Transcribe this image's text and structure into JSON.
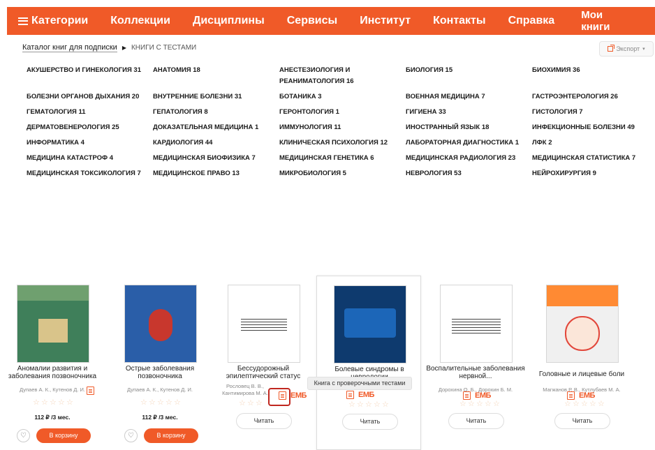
{
  "nav": {
    "categories": "Категории",
    "items": [
      "Коллекции",
      "Дисциплины",
      "Сервисы",
      "Институт",
      "Контакты",
      "Справка"
    ],
    "my_books": "Мои книги"
  },
  "breadcrumb": {
    "catalog": "Каталог книг для подписки",
    "separator": "▶",
    "current": "КНИГИ С ТЕСТАМИ"
  },
  "export": {
    "label": "Экспорт"
  },
  "categories": [
    "АКУШЕРСТВО И ГИНЕКОЛОГИЯ 31",
    "АНАТОМИЯ 18",
    "АНЕСТЕЗИОЛОГИЯ И РЕАНИМАТОЛОГИЯ 16",
    "БИОЛОГИЯ 15",
    "БИОХИМИЯ 36",
    "БОЛЕЗНИ ОРГАНОВ ДЫХАНИЯ 20",
    "ВНУТРЕННИЕ БОЛЕЗНИ 31",
    "БОТАНИКА 3",
    "ВОЕННАЯ МЕДИЦИНА 7",
    "ГАСТРОЭНТЕРОЛОГИЯ 26",
    "ГЕМАТОЛОГИЯ 11",
    "ГЕПАТОЛОГИЯ 8",
    "ГЕРОНТОЛОГИЯ 1",
    "ГИГИЕНА 33",
    "ГИСТОЛОГИЯ 7",
    "ДЕРМАТОВЕНЕРОЛОГИЯ 25",
    "ДОКАЗАТЕЛЬНАЯ МЕДИЦИНА 1",
    "ИММУНОЛОГИЯ 11",
    "ИНОСТРАННЫЙ ЯЗЫК 18",
    "ИНФЕКЦИОННЫЕ БОЛЕЗНИ 49",
    "ИНФОРМАТИКА 4",
    "КАРДИОЛОГИЯ 44",
    "КЛИНИЧЕСКАЯ ПСИХОЛОГИЯ 12",
    "ЛАБОРАТОРНАЯ ДИАГНОСТИКА 1",
    "ЛФК 2",
    "МЕДИЦИНА КАТАСТРОФ 4",
    "МЕДИЦИНСКАЯ БИОФИЗИКА 7",
    "МЕДИЦИНСКАЯ ГЕНЕТИКА 6",
    "МЕДИЦИНСКАЯ РАДИОЛОГИЯ 23",
    "МЕДИЦИНСКАЯ СТАТИСТИКА 7",
    "МЕДИЦИНСКАЯ ТОКСИКОЛОГИЯ 7",
    "МЕДИЦИНСКОЕ ПРАВО 13",
    "МИКРОБИОЛОГИЯ 5",
    "НЕВРОЛОГИЯ 53",
    "НЕЙРОХИРУРГИЯ 9"
  ],
  "books": [
    {
      "title": "Аномалии развития и заболевания позвоночника",
      "authors": "Дупаев А. К., Кутенов Д. И.",
      "rating": 0,
      "price": "112 ₽ /3 мес.",
      "cart": "В корзину",
      "has_test": true,
      "cover": [
        "#3f7f5a",
        "#d9c48a",
        "#6fa06f"
      ]
    },
    {
      "title": "Острые заболевания позвоночника",
      "authors": "Дупаев А. К., Кутенов Д. И.",
      "rating": 0,
      "price": "112 ₽ /3 мес.",
      "cart": "В корзину",
      "has_test": false,
      "cover": [
        "#2a5ea8",
        "#c8372d",
        "#2a5ea8"
      ]
    },
    {
      "title": "Бессудорожный эпилептический статус",
      "authors": "Рословец В. В., Кантимирова М. А.",
      "rating": 0,
      "read": "Читать",
      "has_test": true,
      "evm": "ЕМБ",
      "cover": [
        "#ffffff",
        "#ffffff",
        "#ffffff"
      ]
    },
    {
      "title": "Болевые синдромы в неврологии",
      "authors": "",
      "rating": 0,
      "read": "Читать",
      "has_test": true,
      "evm": "ЕМБ",
      "cover": [
        "#0e3a6e",
        "#1c66b8",
        "#0e3a6e"
      ]
    },
    {
      "title": "Воспалительные заболевания нервной...",
      "authors": "Дорохина О. Б., Дорохин Б. М.",
      "rating": 0,
      "read": "Читать",
      "has_test": true,
      "evm": "ЕМБ",
      "cover": [
        "#ffffff",
        "#ffffff",
        "#ffffff"
      ]
    },
    {
      "title": "Головные и лицевые боли",
      "authors": "Магжанов Р. В., Кутлубаев М. А.",
      "rating": 0,
      "read": "Читать",
      "has_test": true,
      "evm": "ЕМБ",
      "cover": [
        "#ff8a33",
        "#fbe6d9",
        "#f0f0f0"
      ]
    }
  ],
  "tooltip": "Книга с проверочными тестами",
  "colors": {
    "brand": "#f05a28",
    "highlight": "#c0271f"
  }
}
